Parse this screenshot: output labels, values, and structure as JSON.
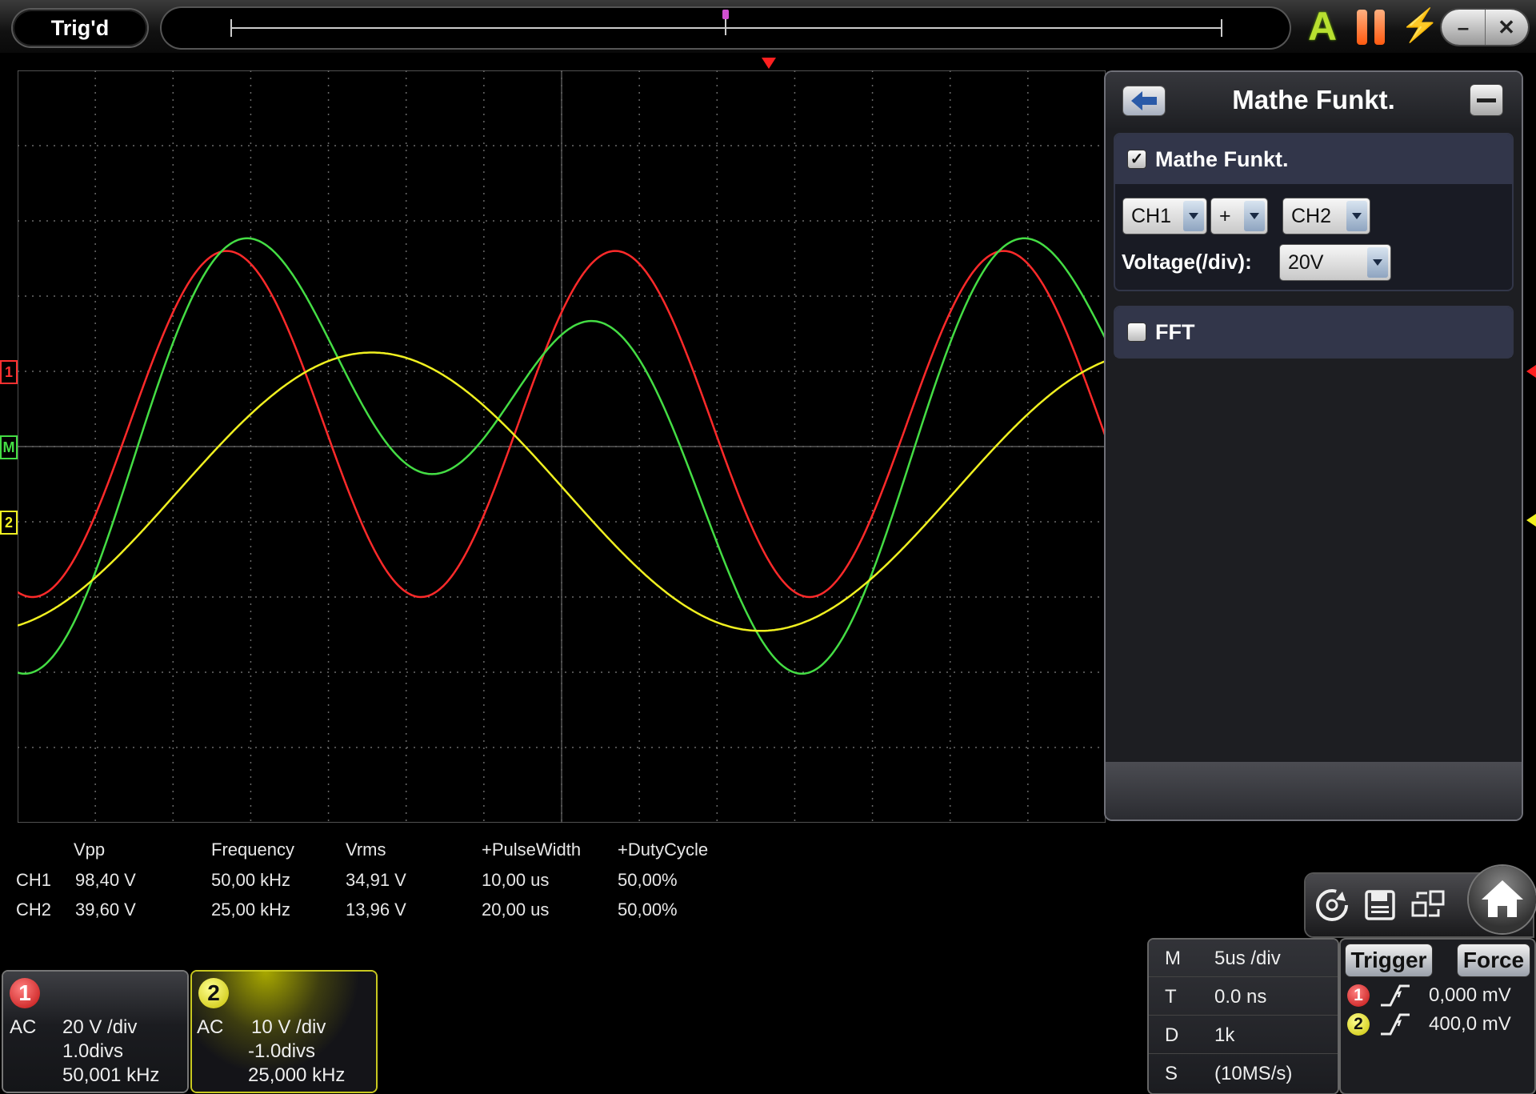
{
  "status": {
    "trigger_state": "Trig'd"
  },
  "toolbar": {
    "auto_icon": "A"
  },
  "math_panel": {
    "title": "Mathe Funkt.",
    "math_section": {
      "label": "Mathe Funkt.",
      "checked": true,
      "source1": "CH1",
      "operator": "+",
      "source2": "CH2",
      "voltage_label": "Voltage(/div):",
      "voltage_value": "20V"
    },
    "fft_section": {
      "label": "FFT",
      "checked": false
    }
  },
  "markers": {
    "ch1": "1",
    "math": "M",
    "ch2": "2"
  },
  "measurements": {
    "headers": [
      "Vpp",
      "Frequency",
      "Vrms",
      "+PulseWidth",
      "+DutyCycle"
    ],
    "rows": [
      {
        "ch": "CH1",
        "values": [
          "98,40 V",
          "50,00 kHz",
          "34,91 V",
          "10,00 us",
          "50,00%"
        ]
      },
      {
        "ch": "CH2",
        "values": [
          "39,60 V",
          "25,00 kHz",
          "13,96 V",
          "20,00 us",
          "50,00%"
        ]
      }
    ]
  },
  "channels": [
    {
      "num": "1",
      "coupling": "AC",
      "scale": "20 V /div",
      "offset": "1.0divs",
      "freq": "50,001 kHz",
      "color": "#e02020"
    },
    {
      "num": "2",
      "coupling": "AC",
      "scale": "10 V /div",
      "offset": "-1.0divs",
      "freq": "25,000 kHz",
      "color": "#e8e020"
    }
  ],
  "timebase": [
    {
      "key": "M",
      "value": "5us /div"
    },
    {
      "key": "T",
      "value": "0.0 ns"
    },
    {
      "key": "D",
      "value": "1k"
    },
    {
      "key": "S",
      "value": "(10MS/s)"
    }
  ],
  "trigger": {
    "trigger_label": "Trigger",
    "force_label": "Force",
    "levels": [
      {
        "ch": "1",
        "value": "0,000 mV"
      },
      {
        "ch": "2",
        "value": "400,0 mV"
      }
    ]
  },
  "colors": {
    "ch1": "#ff2a2a",
    "ch2": "#f0f020",
    "math": "#44dd44",
    "grid": "#6a6a6a"
  },
  "icons": [
    "auto-icon",
    "pause-icon",
    "bolt-icon",
    "minimize-icon",
    "close-icon",
    "back-arrow-icon",
    "collapse-icon",
    "refresh-icon",
    "save-icon",
    "channel-switch-icon",
    "home-icon",
    "rising-edge-icon"
  ]
}
